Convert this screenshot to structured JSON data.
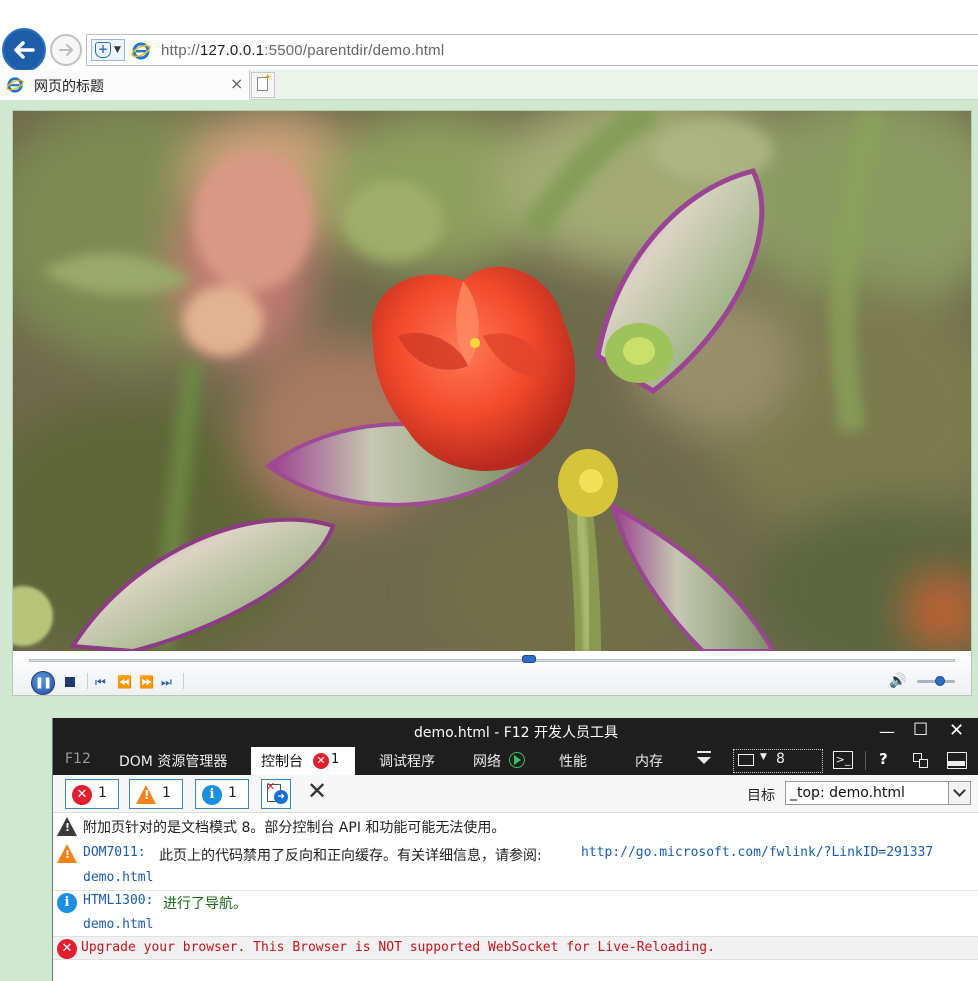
{
  "browser": {
    "url_scheme": "http://",
    "url_host": "127.0.0.1",
    "url_rest": ":5500/parentdir/demo.html",
    "tab_title": "网页的标题",
    "tab_close": "×",
    "icons": [
      "back-arrow-icon",
      "forward-arrow-icon",
      "compat-view-icon",
      "ie-logo-icon",
      "new-tab-icon"
    ]
  },
  "player": {
    "seek_fraction": 0.54,
    "volume_fraction": 0.6,
    "state": "playing",
    "icons": [
      "pause-icon",
      "stop-icon",
      "previous-icon",
      "rewind-icon",
      "fast-forward-icon",
      "next-icon",
      "volume-icon"
    ]
  },
  "devtools": {
    "title": "demo.html - F12 开发人员工具",
    "tabs": {
      "f12": "F12",
      "dom": "DOM 资源管理器",
      "console": "控制台",
      "console_errors": "1",
      "debugger": "调试程序",
      "network": "网络",
      "performance": "性能",
      "memory": "内存"
    },
    "document_mode": "8",
    "filters": {
      "errors": "1",
      "warnings": "1",
      "info": "1"
    },
    "target_label": "目标",
    "target_value": "_top: demo.html",
    "messages": {
      "notice": "附加页针对的是文档模式 8。部分控制台 API 和功能可能无法使用。",
      "warn_code": "DOM7011:",
      "warn_text": "此页上的代码禁用了反向和正向缓存。有关详细信息，请参阅:",
      "warn_link": "http://go.microsoft.com/fwlink/?LinkID=291337",
      "warn_source": "demo.html",
      "info_code": "HTML1300:",
      "info_text": "进行了导航。",
      "info_source": "demo.html",
      "error_text": "Upgrade your browser. This Browser is NOT supported WebSocket for Live-Reloading."
    },
    "colors": {
      "error": "#e0202e",
      "warning": "#f0841a",
      "info": "#1b8fe0",
      "link": "#1a5fa8"
    }
  }
}
